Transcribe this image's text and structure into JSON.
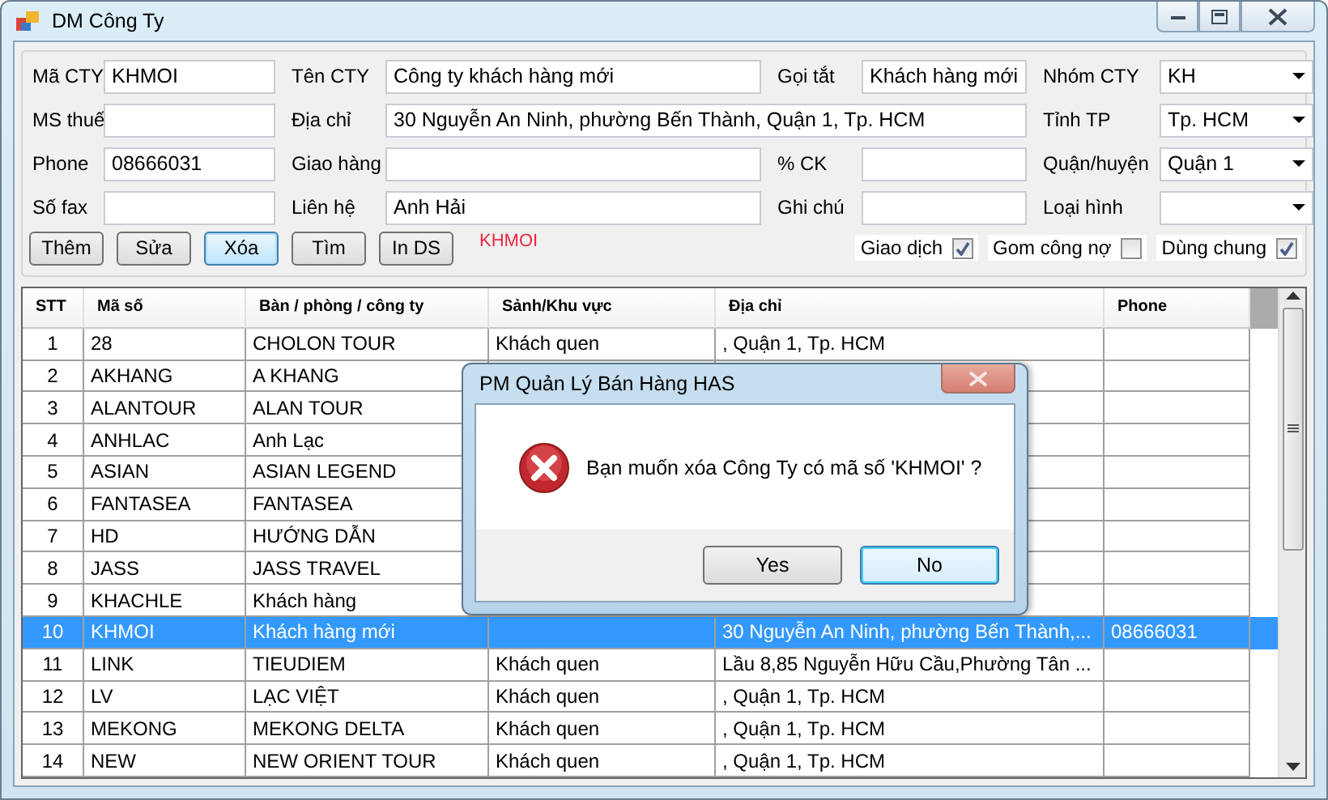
{
  "window": {
    "title": "DM Công Ty"
  },
  "form": {
    "fields": [
      {
        "label": "Mã CTY",
        "value": "KHMOI",
        "kind": "text"
      },
      {
        "label": "Tên CTY",
        "value": "Công ty khách hàng mới",
        "kind": "text"
      },
      {
        "label": "Gọi tắt",
        "value": "Khách hàng mới",
        "kind": "text"
      },
      {
        "label": "Nhóm CTY",
        "value": "KH",
        "kind": "combo"
      },
      {
        "label": "MS thuế",
        "kind": "text"
      },
      {
        "label": "Địa chỉ",
        "value": "30 Nguyễn An Ninh, phường Bến Thành, Quận 1, Tp. HCM",
        "kind": "wide"
      },
      {
        "label": "Tỉnh TP",
        "value": "Tp. HCM",
        "kind": "combo"
      },
      {
        "label": "Phone",
        "value": "08666031",
        "kind": "text"
      },
      {
        "label": "Giao hàng",
        "kind": "text"
      },
      {
        "label": "% CK",
        "kind": "text"
      },
      {
        "label": "Quận/huyện",
        "value": "Quận 1",
        "kind": "combo"
      },
      {
        "label": "Số fax",
        "kind": "text"
      },
      {
        "label": "Liên hệ",
        "value": "Anh Hải",
        "kind": "text"
      },
      {
        "label": "Ghi chú",
        "kind": "text"
      },
      {
        "label": "Loại hình",
        "kind": "combo"
      }
    ],
    "buttons": [
      {
        "label": "Thêm",
        "focused": false
      },
      {
        "label": "Sửa",
        "focused": false
      },
      {
        "label": "Xóa",
        "focused": true
      },
      {
        "label": "Tìm",
        "focused": false
      },
      {
        "label": "In DS",
        "focused": false
      }
    ],
    "current_code": "KHMOI",
    "checkboxes": [
      {
        "label": "Giao dịch",
        "checked": true
      },
      {
        "label": "Gom công nợ",
        "checked": false
      },
      {
        "label": "Dùng chung",
        "checked": true
      }
    ]
  },
  "table": {
    "columns": [
      "STT",
      "Mã số",
      "Bàn / phòng / công ty",
      "Sảnh/Khu vực",
      "Địa chỉ",
      "Phone"
    ],
    "rows": [
      {
        "stt": "1",
        "ma_so": "28",
        "ten": "CHOLON TOUR",
        "sanh": "Khách quen",
        "dia_chi": ", Quận 1, Tp. HCM",
        "selected": false
      },
      {
        "stt": "2",
        "ma_so": "AKHANG",
        "ten": "A KHANG",
        "selected": false
      },
      {
        "stt": "3",
        "ma_so": "ALANTOUR",
        "ten": "ALAN TOUR",
        "selected": false
      },
      {
        "stt": "4",
        "ma_so": "ANHLAC",
        "ten": "Anh Lạc",
        "selected": false
      },
      {
        "stt": "5",
        "ma_so": "ASIAN",
        "ten": "ASIAN LEGEND",
        "selected": false
      },
      {
        "stt": "6",
        "ma_so": "FANTASEA",
        "ten": "FANTASEA",
        "selected": false
      },
      {
        "stt": "7",
        "ma_so": "HD",
        "ten": "HƯỚNG DẪN",
        "selected": false
      },
      {
        "stt": "8",
        "ma_so": "JASS",
        "ten": "JASS TRAVEL",
        "selected": false
      },
      {
        "stt": "9",
        "ma_so": "KHACHLE",
        "ten": "Khách hàng",
        "selected": false
      },
      {
        "stt": "10",
        "ma_so": "KHMOI",
        "ten": "Khách hàng mới",
        "dia_chi": "30 Nguyễn An Ninh, phường Bến Thành,...",
        "phone": "08666031",
        "selected": true
      },
      {
        "stt": "11",
        "ma_so": "LINK",
        "ten": "TIEUDIEM",
        "sanh": "Khách quen",
        "dia_chi": "Lầu 8,85 Nguyễn Hữu Cầu,Phường Tân ...",
        "selected": false
      },
      {
        "stt": "12",
        "ma_so": "LV",
        "ten": "LẠC VIỆT",
        "sanh": "Khách quen",
        "dia_chi": ", Quận 1, Tp. HCM",
        "selected": false
      },
      {
        "stt": "13",
        "ma_so": "MEKONG",
        "ten": "MEKONG DELTA",
        "sanh": "Khách quen",
        "dia_chi": ", Quận 1, Tp. HCM",
        "selected": false
      },
      {
        "stt": "14",
        "ma_so": "NEW",
        "ten": "NEW ORIENT TOUR",
        "sanh": "Khách quen",
        "dia_chi": ", Quận 1, Tp. HCM",
        "selected": false
      }
    ]
  },
  "dialog": {
    "title": "PM Quản Lý Bán Hàng HAS",
    "message": "Bạn muốn xóa Công Ty có mã số 'KHMOI' ?",
    "buttons": [
      {
        "label": "Yes",
        "focused": false
      },
      {
        "label": "No",
        "focused": true
      }
    ]
  }
}
